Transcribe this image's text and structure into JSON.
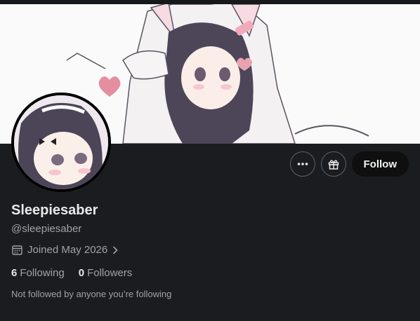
{
  "profile": {
    "display_name": "Sleepiesaber",
    "handle": "@sleepiesaber",
    "joined": "Joined May 2026",
    "following_count": "6",
    "following_label": "Following",
    "followers_count": "0",
    "followers_label": "Followers",
    "followed_by_note": "Not followed by anyone you’re following"
  },
  "actions": {
    "more_icon": "more-horizontal-icon",
    "gift_icon": "gift-icon",
    "follow_label": "Follow"
  },
  "icons": {
    "calendar": "calendar-icon",
    "chevron": "chevron-right-icon"
  },
  "colors": {
    "background": "#1b1c1f",
    "banner": "#fdfdfd",
    "follow_button": "#0f0f0f",
    "muted_text": "#9ea3a8"
  }
}
